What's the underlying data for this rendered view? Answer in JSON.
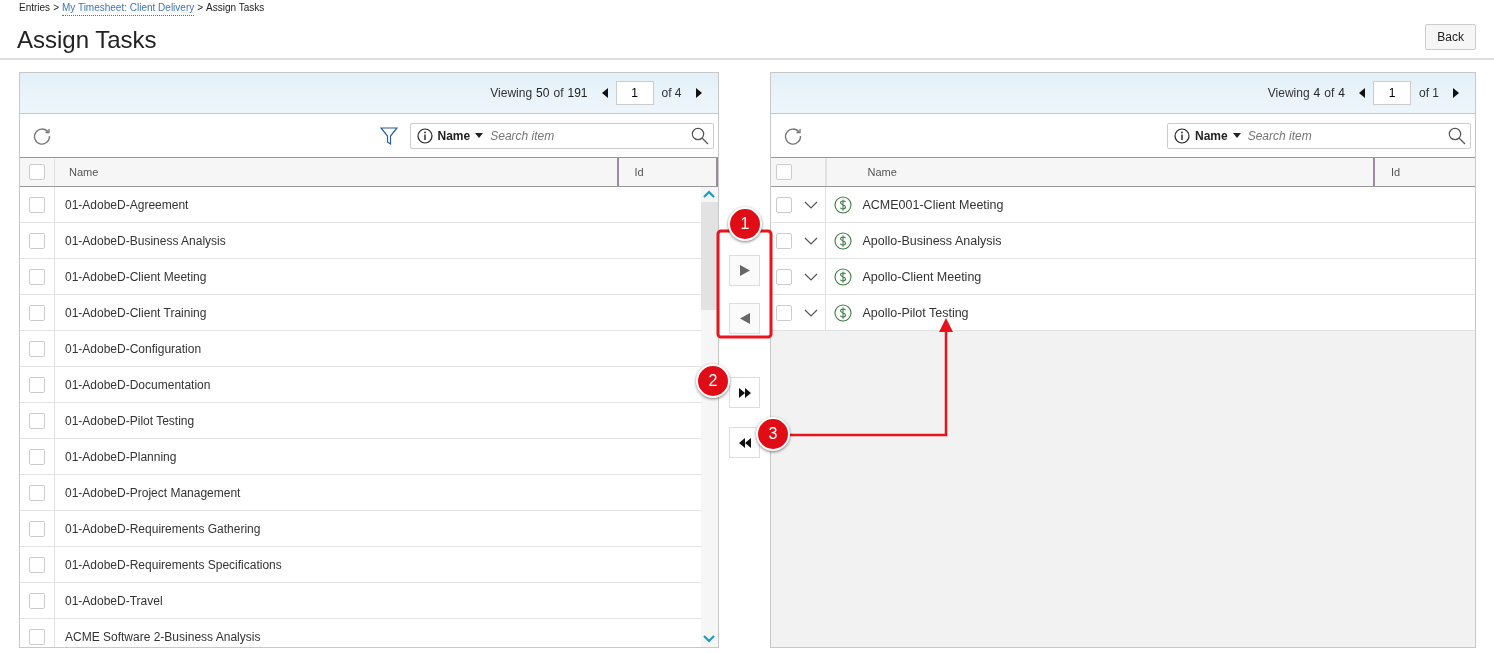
{
  "breadcrumb": {
    "separator": ">",
    "items": [
      {
        "label": "Entries",
        "link": false
      },
      {
        "label": "My Timesheet: Client Delivery",
        "link": true
      },
      {
        "label": "Assign Tasks",
        "link": false
      }
    ]
  },
  "title": "Assign Tasks",
  "back_button": "Back",
  "left_panel": {
    "select_all_checked": false,
    "viewing_label": "Viewing",
    "shown": "50",
    "of_label": "of",
    "total": "191",
    "page": "1",
    "pages": "of 4",
    "search": {
      "field": "Name",
      "placeholder": "Search item"
    },
    "columns": [
      "Name",
      "Id"
    ],
    "rows": [
      {
        "name": "01-AdobeD-Agreement",
        "checked": false
      },
      {
        "name": "01-AdobeD-Business Analysis",
        "checked": false
      },
      {
        "name": "01-AdobeD-Client Meeting",
        "checked": false
      },
      {
        "name": "01-AdobeD-Client Training",
        "checked": false
      },
      {
        "name": "01-AdobeD-Configuration",
        "checked": false
      },
      {
        "name": "01-AdobeD-Documentation",
        "checked": false
      },
      {
        "name": "01-AdobeD-Pilot Testing",
        "checked": false
      },
      {
        "name": "01-AdobeD-Planning",
        "checked": false
      },
      {
        "name": "01-AdobeD-Project Management",
        "checked": false
      },
      {
        "name": "01-AdobeD-Requirements Gathering",
        "checked": false
      },
      {
        "name": "01-AdobeD-Requirements Specifications",
        "checked": false
      },
      {
        "name": "01-AdobeD-Travel",
        "checked": false
      },
      {
        "name": "ACME Software 2-Business Analysis",
        "checked": false
      }
    ]
  },
  "transfer_buttons": [
    {
      "kind": "move-right"
    },
    {
      "kind": "move-left"
    },
    {
      "kind": "move-all-right"
    },
    {
      "kind": "move-all-left"
    }
  ],
  "right_panel": {
    "select_all_checked": false,
    "viewing_label": "Viewing",
    "shown": "4",
    "of_label": "of",
    "total": "4",
    "page": "1",
    "pages": "of 1",
    "search": {
      "field": "Name",
      "placeholder": "Search item"
    },
    "columns": [
      "Name",
      "Id"
    ],
    "rows": [
      {
        "name": "ACME001-Client Meeting",
        "checked": false
      },
      {
        "name": "Apollo-Business Analysis",
        "checked": false
      },
      {
        "name": "Apollo-Client Meeting",
        "checked": false
      },
      {
        "name": "Apollo-Pilot Testing",
        "checked": false
      }
    ]
  },
  "callouts": [
    "1",
    "2",
    "3"
  ]
}
